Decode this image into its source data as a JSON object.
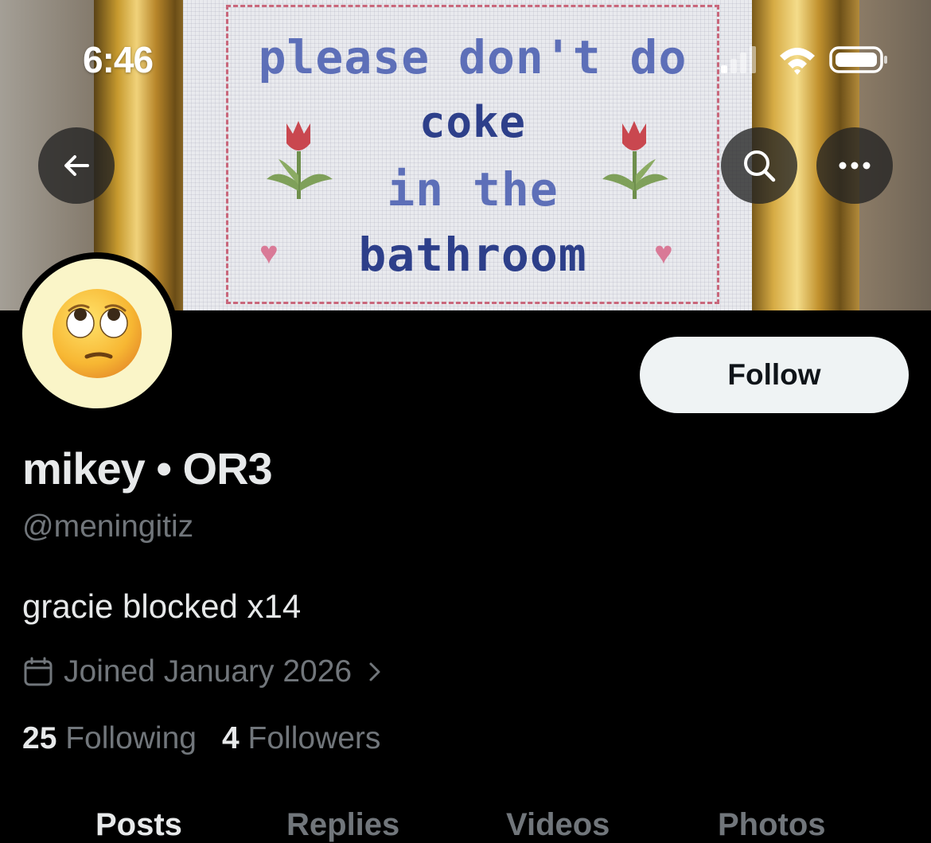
{
  "status_bar": {
    "time": "6:46"
  },
  "banner": {
    "embroidery_lines": [
      "please don't do",
      "coke",
      "in the",
      "bathroom"
    ]
  },
  "nav": {
    "back_icon": "arrow-left-icon",
    "search_icon": "search-icon",
    "more_icon": "more-horizontal-icon"
  },
  "profile": {
    "avatar_emoji": "🙄",
    "follow_label": "Follow",
    "display_name": "mikey • OR3",
    "handle": "@meningitiz",
    "bio": "gracie blocked x14",
    "joined": "Joined January 2026",
    "following_count": "25",
    "following_label": "Following",
    "followers_count": "4",
    "followers_label": "Followers"
  },
  "tabs": [
    {
      "label": "Posts",
      "active": true
    },
    {
      "label": "Replies",
      "active": false
    },
    {
      "label": "Videos",
      "active": false
    },
    {
      "label": "Photos",
      "active": false
    }
  ],
  "colors": {
    "background": "#000000",
    "follow_button_bg": "#eff3f4",
    "secondary_text": "#71767b",
    "primary_text": "#e7e9ea"
  }
}
